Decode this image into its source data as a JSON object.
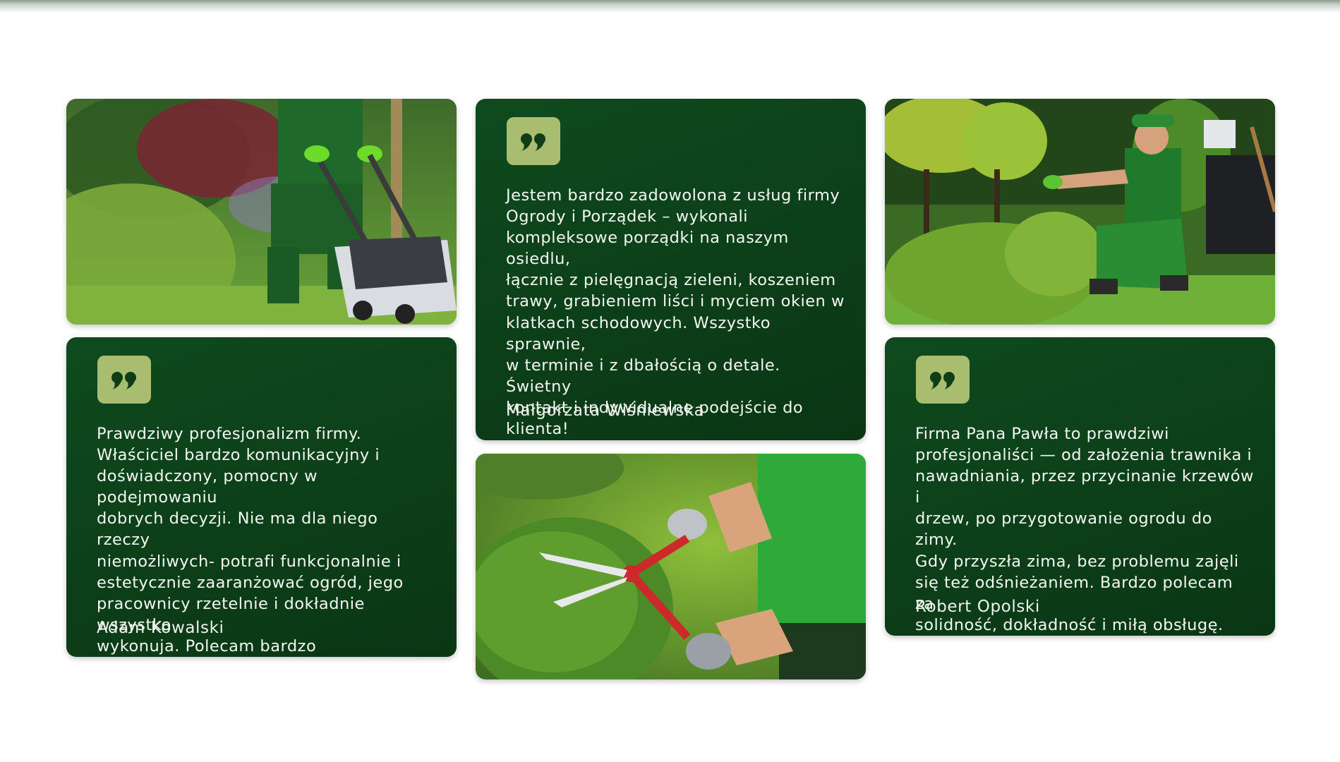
{
  "testimonials": [
    {
      "text": "Jestem bardzo zadowolona z usług firmy\nOgrody i Porządek – wykonali\nkompleksowe porządki na naszym osiedlu,\nłącznie z pielęgnacją zieleni, koszeniem\ntrawy, grabieniem liści i myciem okien w\nklatkach schodowych. Wszystko sprawnie,\nw terminie i z dbałością o detale. Świetny\nkontakt i indywidualne podejście do\nklienta!",
      "author": "Małgorzata Wiśniewska"
    },
    {
      "text": "Prawdziwy profesjonalizm firmy.\nWłaściciel bardzo komunikacyjny i\ndoświadczony, pomocny w podejmowaniu\ndobrych decyzji. Nie ma dla niego rzeczy\nniemożliwych- potrafi funkcjonalnie i\nestetycznie zaaranżować ogród, jego\npracownicy rzetelnie i dokładnie wszystko\nwykonuja. Polecam bardzo",
      "author": "Adam Kowalski"
    },
    {
      "text": "Firma Pana Pawła to prawdziwi\nprofesjonaliści — od założenia trawnika i\nnawadniania, przez przycinanie krzewów i\ndrzew, po przygotowanie ogrodu do zimy.\nGdy przyszła zima, bez problemu zajęli\nsię też odśnieżaniem. Bardzo polecam za\nsolidność, dokładność i miłą obsługę.",
      "author": "Robert Opolski"
    }
  ],
  "photos": [
    {
      "icon": "lawn-mower-photo"
    },
    {
      "icon": "hedge-trimming-photo"
    },
    {
      "icon": "hedge-shears-photo"
    }
  ],
  "colors": {
    "card_green": "#0f4a1e",
    "badge_olive": "#a8bd6f",
    "quote_mark": "#0f3d17"
  }
}
